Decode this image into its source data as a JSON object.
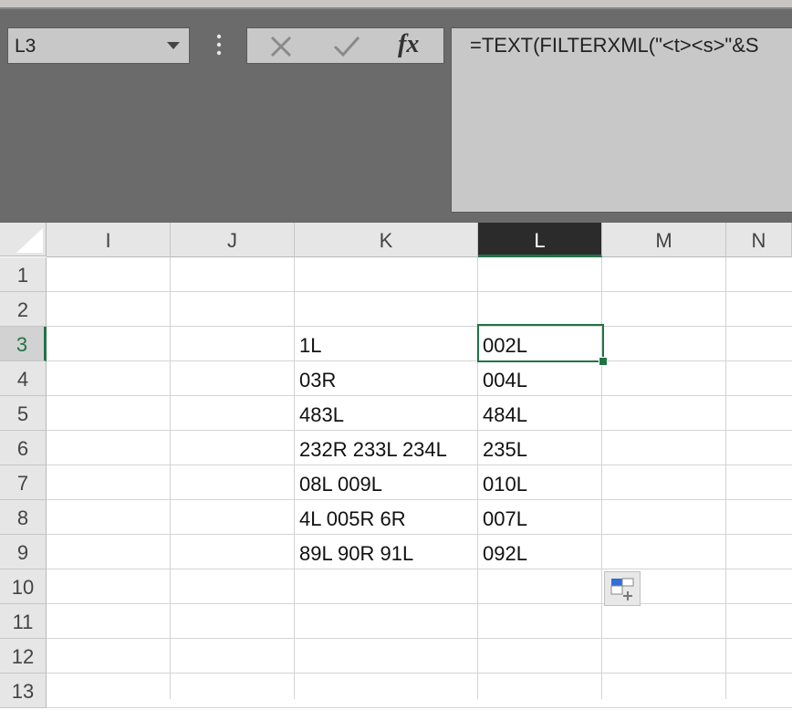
{
  "formula_bar": {
    "name_box_value": "L3",
    "formula_text": "=TEXT(FILTERXML(\"<t><s>\"&S",
    "fx_label": "fx"
  },
  "columns": [
    "I",
    "J",
    "K",
    "L",
    "M",
    "N"
  ],
  "active_column": "L",
  "rows": [
    "1",
    "2",
    "3",
    "4",
    "5",
    "6",
    "7",
    "8",
    "9",
    "10",
    "11",
    "12",
    "13"
  ],
  "active_row": "3",
  "cells": {
    "K": [
      "1L",
      "03R",
      "483L",
      "232R 233L 234L",
      "08L 009L",
      "4L 005R 6R",
      "89L 90R 91L"
    ],
    "L": [
      "002L",
      "004L",
      "484L",
      "235L",
      "010L",
      "007L",
      "092L"
    ]
  },
  "colors": {
    "accent": "#217346",
    "formula_bg": "#6b6b6b",
    "header_bg": "#e6e6e6"
  },
  "icons": [
    "chevron-down-icon",
    "more-options-icon",
    "cancel-icon",
    "enter-icon",
    "quick-analysis-icon"
  ]
}
